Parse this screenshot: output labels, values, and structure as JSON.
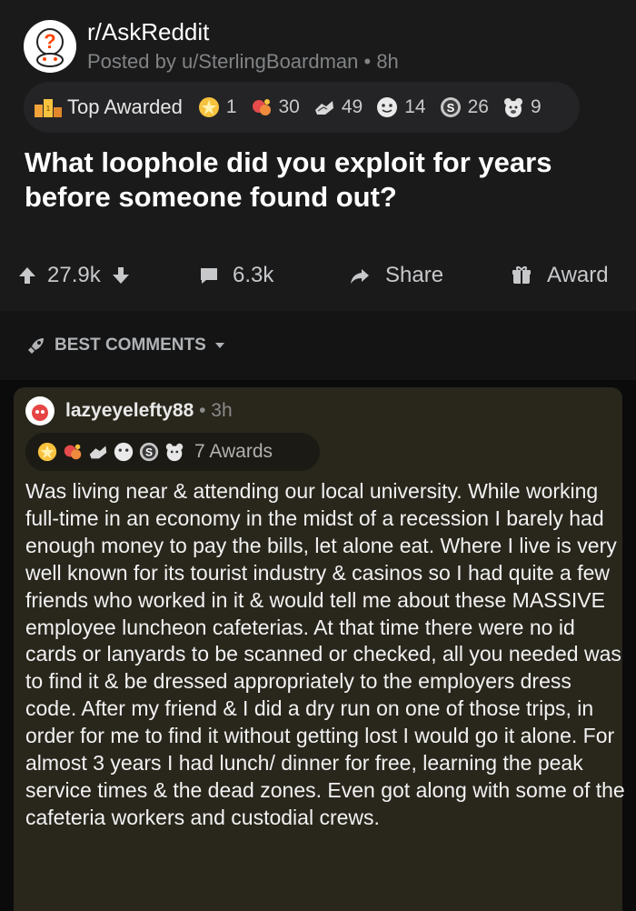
{
  "post": {
    "subreddit": "r/AskReddit",
    "posted_by": "Posted by u/SterlingBoardman • 8h",
    "title": "What loophole did you exploit for years before someone found out?",
    "awards_label": "Top Awarded",
    "awards": [
      {
        "icon": "gold-award-icon",
        "count": "1"
      },
      {
        "icon": "wholesome-award-icon",
        "count": "30"
      },
      {
        "icon": "helpful-award-icon",
        "count": "49"
      },
      {
        "icon": "hugz-award-icon",
        "count": "14"
      },
      {
        "icon": "silver-award-icon",
        "count": "26"
      },
      {
        "icon": "bear-award-icon",
        "count": "9"
      }
    ],
    "votes": "27.9k",
    "comments_count": "6.3k",
    "share_label": "Share",
    "award_label": "Award"
  },
  "sort": {
    "label": "BEST COMMENTS"
  },
  "comment": {
    "username": "lazyeyelefty88",
    "time": " • 3h",
    "awards_text": "7 Awards",
    "body": "Was living near & attending our local university. While working full-time in an economy in the midst of a recession I barely had enough money to pay the bills, let alone eat. Where I live is very well known for its tourist industry & casinos so I had quite a few friends who worked in it & would tell me about these MASSIVE employee luncheon cafeterias. At that time there were no id cards or lanyards to be scanned or checked, all you needed was to find it & be dressed appropriately to the employers dress code. After my friend & I did a dry run on one of those trips, in order for me to find it without getting lost I would go it alone. For almost 3 years I had lunch/ dinner for free, learning the peak service times & the dead zones. Even got along with some of the cafeteria workers and custodial crews."
  },
  "colors": {
    "background": "#0b0b0c",
    "card": "#1a1a1b",
    "comment_bg": "#29261c",
    "accent_orange": "#ff4500"
  }
}
